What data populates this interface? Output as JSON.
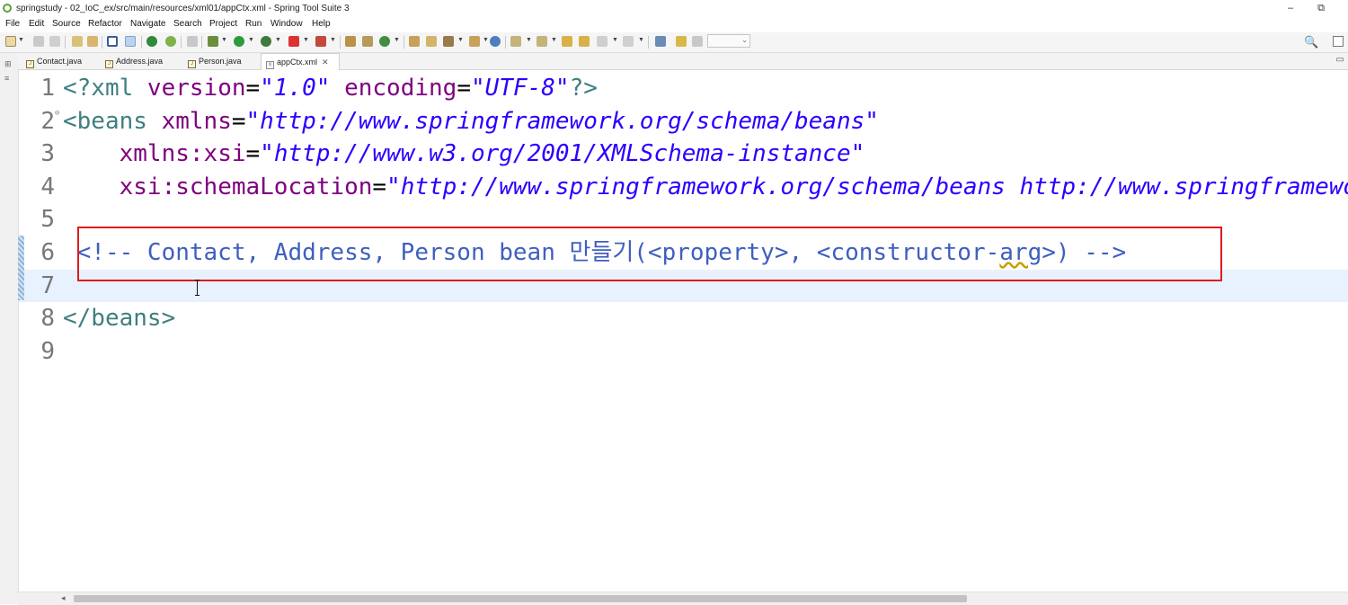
{
  "window": {
    "title": "springstudy - 02_IoC_ex/src/main/resources/xml01/appCtx.xml - Spring Tool Suite 3",
    "minimize_glyph": "–",
    "restore_glyph": "⧉"
  },
  "menu": [
    "File",
    "Edit",
    "Source",
    "Refactor",
    "Navigate",
    "Search",
    "Project",
    "Run",
    "Window",
    "Help"
  ],
  "toolbar": {
    "icons": [
      "new-icon",
      "save-icon",
      "save-all-icon",
      "print-icon",
      "properties-icon",
      "toggle-breadcrumb-icon",
      "mark-occurrences-icon",
      "skip-breakpoints-icon",
      "spring-icon",
      "debug-icon",
      "run-icon",
      "coverage-icon",
      "stop-icon",
      "external-tools-icon",
      "new-java-project-icon",
      "new-package-icon",
      "new-class-icon",
      "open-type-icon",
      "open-task-icon",
      "search-tool-icon",
      "globe-icon",
      "next-annotation-icon",
      "prev-annotation-icon",
      "last-edit-icon",
      "back-icon",
      "forward-icon",
      "new-window-icon",
      "pin-icon"
    ],
    "quick_access_glyph": "🔍"
  },
  "tabs": [
    {
      "label": "Contact.java",
      "icon": "J",
      "active": false
    },
    {
      "label": "Address.java",
      "icon": "J",
      "active": false
    },
    {
      "label": "Person.java",
      "icon": "J",
      "active": false
    },
    {
      "label": "appCtx.xml",
      "icon": "x",
      "active": true
    }
  ],
  "tab_close_glyph": "✕",
  "editor": {
    "current_line": 7,
    "lines": [
      {
        "n": "1",
        "parts": [
          {
            "t": "<?xml ",
            "c": "pi"
          },
          {
            "t": "version",
            "c": "attr"
          },
          {
            "t": "=",
            "c": "eq"
          },
          {
            "t": "\"1.0\"",
            "c": "val"
          },
          {
            "t": " ",
            "c": "eq"
          },
          {
            "t": "encoding",
            "c": "attr"
          },
          {
            "t": "=",
            "c": "eq"
          },
          {
            "t": "\"UTF-8\"",
            "c": "val"
          },
          {
            "t": "?>",
            "c": "pi"
          }
        ]
      },
      {
        "n": "2",
        "fold": true,
        "parts": [
          {
            "t": "<beans ",
            "c": "tag"
          },
          {
            "t": "xmlns",
            "c": "attr"
          },
          {
            "t": "=",
            "c": "eq"
          },
          {
            "t": "\"http://www.springframework.org/schema/beans\"",
            "c": "val"
          }
        ]
      },
      {
        "n": "3",
        "parts": [
          {
            "t": "    ",
            "c": "eq"
          },
          {
            "t": "xmlns:xsi",
            "c": "attr"
          },
          {
            "t": "=",
            "c": "eq"
          },
          {
            "t": "\"http://www.w3.org/2001/XMLSchema-instance\"",
            "c": "val"
          }
        ]
      },
      {
        "n": "4",
        "parts": [
          {
            "t": "    ",
            "c": "eq"
          },
          {
            "t": "xsi:schemaLocation",
            "c": "attr"
          },
          {
            "t": "=",
            "c": "eq"
          },
          {
            "t": "\"http://www.springframework.org/schema/beans http://www.springframework.org/schema/beans/spring-beans.xsd\">",
            "c": "val"
          }
        ]
      },
      {
        "n": "5",
        "parts": []
      },
      {
        "n": "6",
        "parts": [
          {
            "t": " <!-- Contact, Address, Person bean 만들기(<property>, <constructor-",
            "c": "comment"
          },
          {
            "t": "arg",
            "c": "comment squiggle"
          },
          {
            "t": ">) -->",
            "c": "comment"
          }
        ]
      },
      {
        "n": "7",
        "parts": []
      },
      {
        "n": "8",
        "parts": [
          {
            "t": "</beans>",
            "c": "tag"
          }
        ]
      },
      {
        "n": "9",
        "parts": []
      }
    ]
  }
}
